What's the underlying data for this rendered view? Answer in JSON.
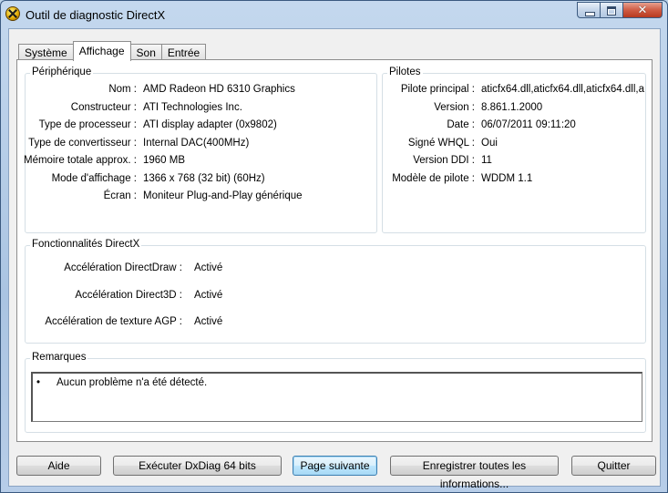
{
  "window": {
    "title": "Outil de diagnostic DirectX",
    "icon": "directx-icon",
    "controls": {
      "minimize": "minimize-icon",
      "maximize": "maximize-icon",
      "close": "✕"
    }
  },
  "tabs": [
    {
      "label": "Système",
      "active": false
    },
    {
      "label": "Affichage",
      "active": true
    },
    {
      "label": "Son",
      "active": false
    },
    {
      "label": "Entrée",
      "active": false
    }
  ],
  "device": {
    "title": "Périphérique",
    "rows": [
      {
        "label": "Nom :",
        "value": "AMD Radeon HD 6310 Graphics"
      },
      {
        "label": "Constructeur :",
        "value": "ATI Technologies Inc."
      },
      {
        "label": "Type de processeur :",
        "value": "ATI display adapter (0x9802)"
      },
      {
        "label": "Type de convertisseur :",
        "value": "Internal DAC(400MHz)"
      },
      {
        "label": "Mémoire totale approx. :",
        "value": "1960 MB"
      },
      {
        "label": "Mode d'affichage :",
        "value": "1366 x 768 (32 bit) (60Hz)"
      },
      {
        "label": "Écran :",
        "value": "Moniteur Plug-and-Play générique"
      }
    ]
  },
  "drivers": {
    "title": "Pilotes",
    "rows": [
      {
        "label": "Pilote principal :",
        "value": "aticfx64.dll,aticfx64.dll,aticfx64.dll,a"
      },
      {
        "label": "Version :",
        "value": "8.861.1.2000"
      },
      {
        "label": "Date :",
        "value": "06/07/2011 09:11:20"
      },
      {
        "label": "Signé WHQL :",
        "value": "Oui"
      },
      {
        "label": "Version DDI :",
        "value": "11"
      },
      {
        "label": "Modèle de pilote :",
        "value": "WDDM 1.1"
      }
    ]
  },
  "features": {
    "title": "Fonctionnalités DirectX",
    "rows": [
      {
        "label": "Accélération DirectDraw :",
        "value": "Activé"
      },
      {
        "label": "Accélération Direct3D :",
        "value": "Activé"
      },
      {
        "label": "Accélération de texture AGP :",
        "value": "Activé"
      }
    ]
  },
  "notes": {
    "title": "Remarques",
    "bullet": "•",
    "items": [
      "Aucun problème n'a été détecté."
    ]
  },
  "buttons": {
    "help": "Aide",
    "run64": "Exécuter DxDiag 64 bits",
    "next": "Page suivante",
    "save": "Enregistrer toutes les informations...",
    "quit": "Quitter"
  }
}
